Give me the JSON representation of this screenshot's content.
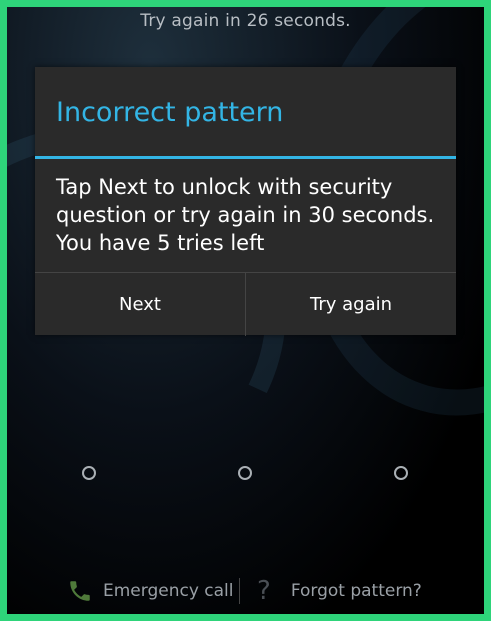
{
  "status": {
    "text": "Try again in 26 seconds."
  },
  "dialog": {
    "title": "Incorrect pattern",
    "message": "Tap Next to unlock with security question or try again in 30 seconds. You have 5 tries left",
    "buttons": {
      "next_label": "Next",
      "try_again_label": "Try again"
    },
    "accent_color": "#33b5e5"
  },
  "pattern": {
    "dots_visible": 3
  },
  "footer": {
    "emergency_label": "Emergency call",
    "emergency_icon": "phone-icon",
    "forgot_label": "Forgot pattern?",
    "forgot_icon": "question-icon"
  },
  "frame_color": "#2ed47a"
}
